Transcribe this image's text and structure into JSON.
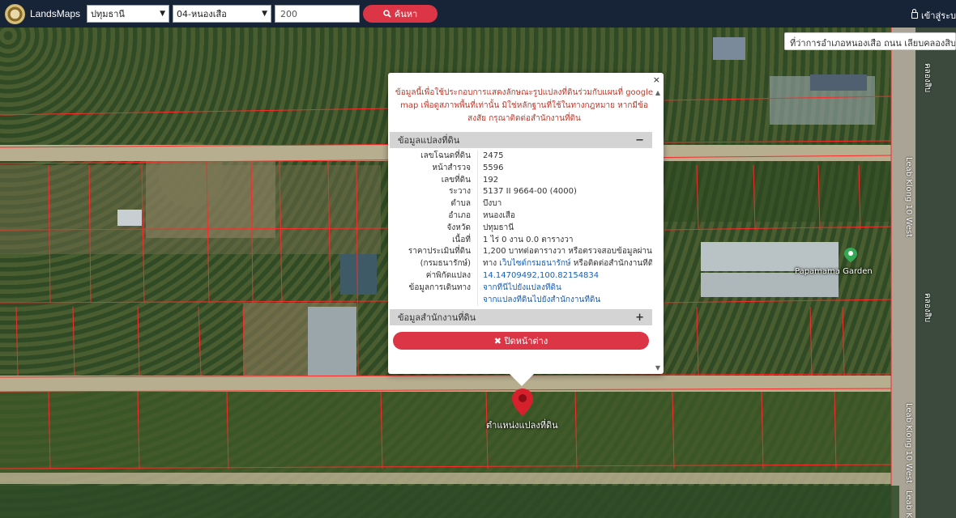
{
  "header": {
    "brand": "LandsMaps",
    "province_select": "ปทุมธานี",
    "district_select": "04-หนองเสือ",
    "parcel_input": "200",
    "search_label": "ค้นหา",
    "login_label": "เข้าสู่ระบ"
  },
  "map": {
    "address_text": "ที่ว่าการอำเภอหนองเสือ ถนน เลียบคลองสิบตะ",
    "road_label_1": "Leab Klong 10 West",
    "road_label_2": "Leab Klong 10 West",
    "road_label_3": "Leab Klo",
    "road_label_thai_1": "คลองสิบ",
    "road_label_thai_2": "คลองสิบ",
    "poi_label": "Papamama Garden",
    "pin_label": "ตำแหน่งแปลงที่ดิน"
  },
  "popup": {
    "close_symbol": "×",
    "notice": "ข้อมูลนี้เพื่อใช้ประกอบการแสดงลักษณะรูปแปลงที่ดินร่วมกับแผนที่ google map เพื่อดูสภาพพื้นที่เท่านั้น มิใช่หลักฐานที่ใช้ในทางกฎหมาย หากมีข้อสงสัย กรุณาติดต่อสำนักงานที่ดิน",
    "section1_title": "ข้อมูลแปลงที่ดิน",
    "section1_symbol": "−",
    "section2_title": "ข้อมูลสำนักงานที่ดิน",
    "section2_symbol": "+",
    "rows": [
      {
        "key": "เลขโฉนดที่ดิน",
        "value": "2475"
      },
      {
        "key": "หน้าสำรวจ",
        "value": "5596"
      },
      {
        "key": "เลขที่ดิน",
        "value": "192"
      },
      {
        "key": "ระวาง",
        "value": "5137 II 9664-00 (4000)"
      },
      {
        "key": "ตำบล",
        "value": "บึงบา"
      },
      {
        "key": "อำเภอ",
        "value": "หนองเสือ"
      },
      {
        "key": "จังหวัด",
        "value": "ปทุมธานี"
      },
      {
        "key": "เนื้อที่",
        "value": "1 ไร่ 0 งาน 0.0 ตารางวา"
      }
    ],
    "price_key_1": "ราคาประเมินที่ดิน",
    "price_key_2": "(กรมธนารักษ์)",
    "price_value_1": "1,200 บาทต่อตารางวา หรือตรวจสอบข้อมูลผ่าน",
    "price_value_2a": "ทาง ",
    "price_value_2b": "เว็บไซต์กรมธนารักษ์",
    "price_value_2c": " หรือติดต่อสำนักงานที่ดิน",
    "coord_key": "ค่าพิกัดแปลง",
    "coord_value": "14.14709492,100.82154834",
    "route_key": "ข้อมูลการเดินทาง",
    "route_link_1": "จากที่นี่ไปยังแปลงที่ดิน",
    "route_link_2": "จากแปลงที่ดินไปยังสำนักงานที่ดิน",
    "close_button": "✖ ปิดหน้าต่าง"
  }
}
